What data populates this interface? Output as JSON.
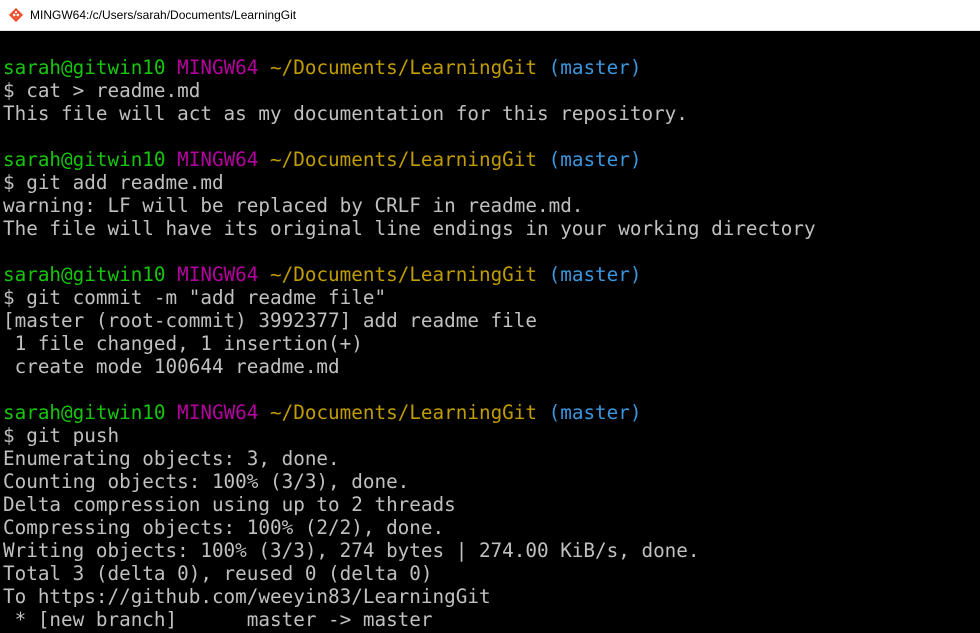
{
  "window": {
    "title": "MINGW64:/c/Users/sarah/Documents/LearningGit",
    "app_icon": "git-bash-icon"
  },
  "prompt": {
    "user": "sarah@gitwin10",
    "system": "MINGW64",
    "path": "~/Documents/LearningGit",
    "branch": "(master)"
  },
  "colors": {
    "background": "#000000",
    "text": "#c0c0c0",
    "user": "#16c60c",
    "system": "#b4009e",
    "path": "#c19c00",
    "branch": "#3a96dd"
  },
  "blocks": [
    {
      "command": "$ cat > readme.md",
      "output": [
        "This file will act as my documentation for this repository."
      ]
    },
    {
      "command": "$ git add readme.md",
      "output": [
        "warning: LF will be replaced by CRLF in readme.md.",
        "The file will have its original line endings in your working directory"
      ]
    },
    {
      "command": "$ git commit -m \"add readme file\"",
      "output": [
        "[master (root-commit) 3992377] add readme file",
        " 1 file changed, 1 insertion(+)",
        " create mode 100644 readme.md"
      ]
    },
    {
      "command": "$ git push",
      "output": [
        "Enumerating objects: 3, done.",
        "Counting objects: 100% (3/3), done.",
        "Delta compression using up to 2 threads",
        "Compressing objects: 100% (2/2), done.",
        "Writing objects: 100% (3/3), 274 bytes | 274.00 KiB/s, done.",
        "Total 3 (delta 0), reused 0 (delta 0)",
        "To https://github.com/weeyin83/LearningGit",
        " * [new branch]      master -> master"
      ]
    }
  ]
}
